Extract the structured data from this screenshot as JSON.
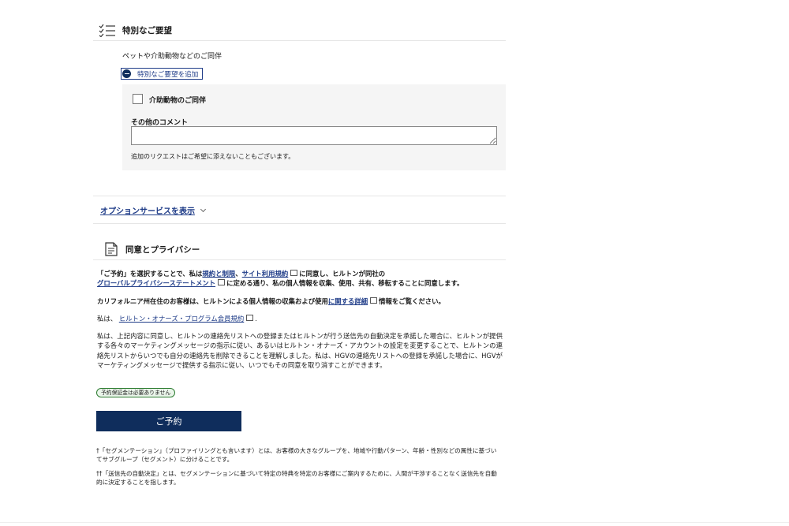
{
  "special_requests": {
    "title": "特別なご要望",
    "subtitle": "ペットや介助動物などのご同伴",
    "toggle_label": "特別なご要望を追加",
    "service_animal_label": "介助動物のご同伴",
    "other_comment_label": "その他のコメント",
    "other_comment_value": "",
    "note": "追加のリクエストはご希望に添えないこともございます。"
  },
  "options_link": "オプションサービスを表示",
  "consent": {
    "title": "同意とプライバシー",
    "p1_a": "「ご予約」を選択することで、私は",
    "p1_link1": "規約と制限",
    "p1_sep": "、",
    "p1_link2": "サイト利用規約",
    "p1_b": "に同意し、ヒルトンが同社の",
    "p1_link3": "グローバルプライバシーステートメント",
    "p1_c": "に定める通り、私の個人情報を収集、使用、共有、移転することに同意します。",
    "p2_a": "カリフォルニア州在住のお客様は、ヒルトンによる個人情報の収集および使用",
    "p2_link": "に関する詳細",
    "p2_b": "情報をご覧ください。",
    "p3_a": "私は、",
    "p3_link": "ヒルトン・オナーズ・プログラム会員規約",
    "p3_b": ".",
    "p4": "私は、上記内容に同意し、ヒルトンの連絡先リストへの登録またはヒルトンが行う送信先の自動決定を承諾した場合に、ヒルトンが提供する各々のマーケティングメッセージの指示に従い、あるいはヒルトン・オナーズ・アカウントの設定を変更することで、ヒルトンの連絡先リストからいつでも自分の連絡先を削除できることを理解しました。私は、HGVの連絡先リストへの登録を承諾した場合に、HGVがマーケティングメッセージで提供する指示に従い、いつでもその同意を取り消すことができます。",
    "badge": "予約保証金は必要ありません",
    "book_button": "ご予約",
    "footnote1": "†「セグメンテーション」（プロファイリングとも言います）とは、お客様の大きなグループを、地域や行動パターン、年齢・性別などの属性に基づいてサブグループ（セグメント）に分けることです。",
    "footnote2": "††「送信先の自動決定」とは、セグメンテーションに基づいて特定の特典を特定のお客様にご案内するために、人間が干渉することなく送信先を自動的に決定することを指します。"
  },
  "colors": {
    "primary": "#0f2d5c",
    "link": "#1f3c88",
    "badge_green": "#2e7d32",
    "panel_bg": "#f5f5f5"
  }
}
